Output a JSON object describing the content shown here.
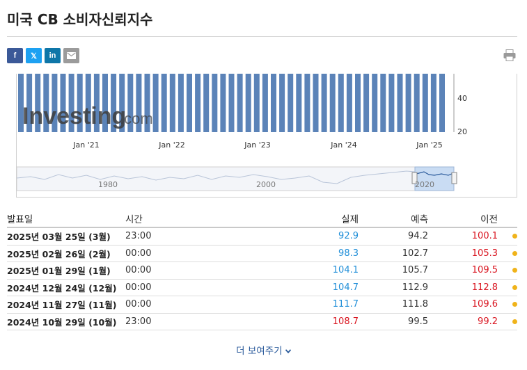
{
  "title": "미국 CB 소비자신뢰지수",
  "share": {
    "facebook_label": "f",
    "twitter_label": "𝕏",
    "linkedin_label": "in",
    "email_icon": "mail-icon",
    "print_icon": "printer-icon"
  },
  "chart": {
    "watermark": "Investing",
    "watermark_suffix": ".com",
    "y_ticks": [
      "40",
      "20"
    ],
    "x_ticks": [
      "Jan '21",
      "Jan '22",
      "Jan '23",
      "Jan '24",
      "Jan '25"
    ],
    "navigator_ticks": [
      "1980",
      "2000",
      "2020"
    ],
    "bar_color": "#5b83b8"
  },
  "table": {
    "headers": {
      "date": "발표일",
      "time": "시간",
      "actual": "실제",
      "forecast": "예측",
      "previous": "이전"
    },
    "rows": [
      {
        "date": "2025년 03월 25일 (3월)",
        "time": "23:00",
        "actual": "92.9",
        "forecast": "94.2",
        "previous": "100.1"
      },
      {
        "date": "2025년 02월 26일 (2월)",
        "time": "00:00",
        "actual": "98.3",
        "forecast": "102.7",
        "previous": "105.3"
      },
      {
        "date": "2025년 01월 29일 (1월)",
        "time": "00:00",
        "actual": "104.1",
        "forecast": "105.7",
        "previous": "109.5"
      },
      {
        "date": "2024년 12월 24일 (12월)",
        "time": "00:00",
        "actual": "104.7",
        "forecast": "112.9",
        "previous": "112.8"
      },
      {
        "date": "2024년 11월 27일 (11월)",
        "time": "00:00",
        "actual": "111.7",
        "forecast": "111.8",
        "previous": "109.6"
      },
      {
        "date": "2024년 10월 29일 (10월)",
        "time": "23:00",
        "actual": "108.7",
        "forecast": "99.5",
        "previous": "99.2"
      }
    ],
    "row_colors": [
      {
        "actual": "blue",
        "previous": "red"
      },
      {
        "actual": "blue",
        "previous": "red"
      },
      {
        "actual": "blue",
        "previous": "red"
      },
      {
        "actual": "blue",
        "previous": "red"
      },
      {
        "actual": "blue",
        "previous": "red"
      },
      {
        "actual": "red",
        "previous": "red"
      }
    ]
  },
  "show_more": "더 보여주기"
}
